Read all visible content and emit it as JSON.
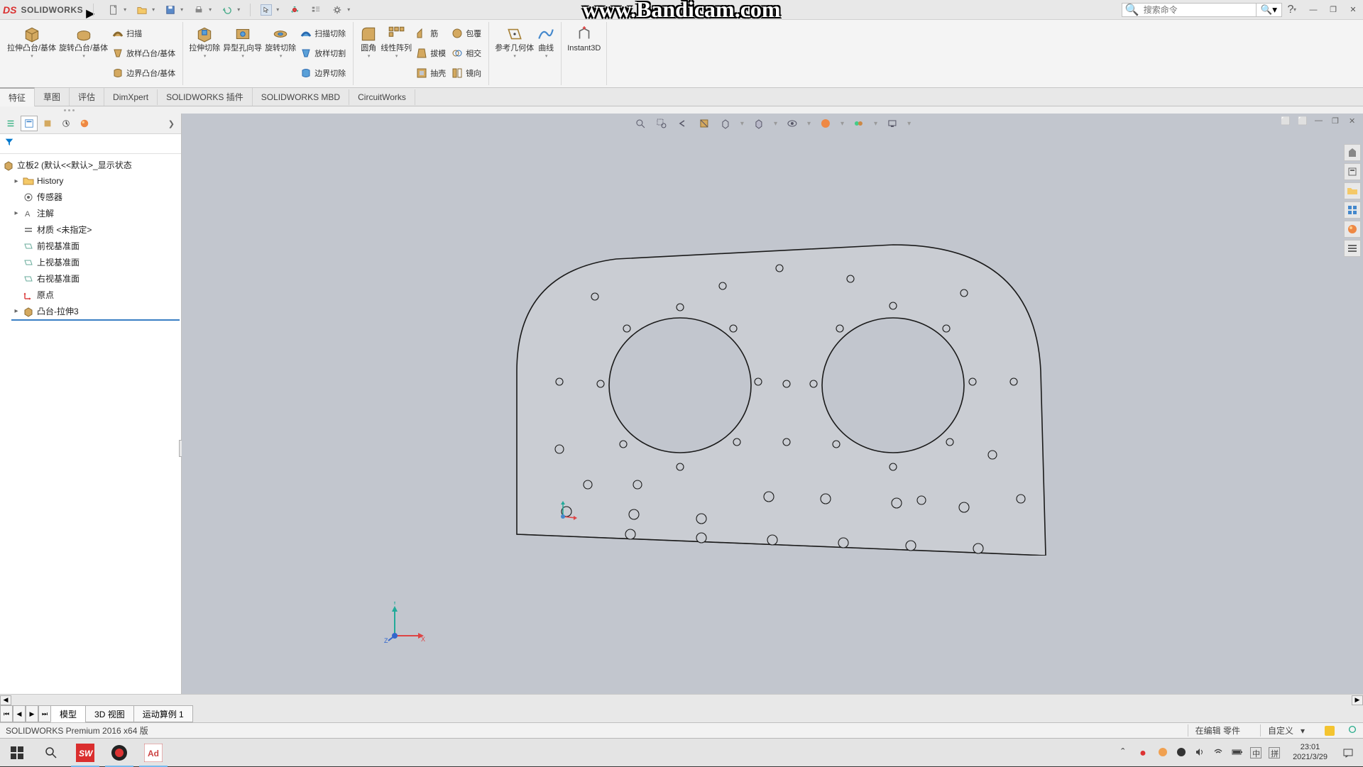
{
  "app": {
    "logo": "DS",
    "name": "SOLIDWORKS",
    "watermark": "www.Bandicam.com",
    "search_placeholder": "搜索命令",
    "help_label": "?"
  },
  "ribbon": {
    "groups": {
      "extrude_boss": "拉伸凸台/基体",
      "revolve_boss": "旋转凸台/基体",
      "swept_boss": "扫描",
      "loft_boss": "放样凸台/基体",
      "boundary_boss": "边界凸台/基体",
      "extrude_cut": "拉伸切除",
      "hole_wizard": "异型孔向导",
      "revolve_cut": "旋转切除",
      "swept_cut": "扫描切除",
      "loft_cut": "放样切割",
      "boundary_cut": "边界切除",
      "fillet": "圆角",
      "linear_pattern": "线性阵列",
      "rib": "筋",
      "draft": "拔模",
      "shell": "抽壳",
      "wrap": "包覆",
      "intersect": "相交",
      "mirror": "镜向",
      "ref_geom": "参考几何体",
      "curves": "曲线",
      "instant3d": "Instant3D"
    }
  },
  "tabs": {
    "features": "特征",
    "sketch": "草图",
    "evaluate": "评估",
    "dimxpert": "DimXpert",
    "sw_addins": "SOLIDWORKS 插件",
    "sw_mbd": "SOLIDWORKS MBD",
    "circuitworks": "CircuitWorks"
  },
  "tree": {
    "root": "立板2 (默认<<默认>_显示状态",
    "history": "History",
    "sensors": "传感器",
    "annotations": "注解",
    "material": "材质 <未指定>",
    "front_plane": "前视基准面",
    "top_plane": "上视基准面",
    "right_plane": "右视基准面",
    "origin": "原点",
    "feature1": "凸台-拉伸3"
  },
  "bottom_tabs": {
    "model": "模型",
    "view3d": "3D 视图",
    "motion": "运动算例 1"
  },
  "status": {
    "product": "SOLIDWORKS Premium 2016 x64 版",
    "editing": "在编辑 零件",
    "custom": "自定义"
  },
  "taskbar": {
    "ime1": "中",
    "ime2": "拼",
    "time": "23:01",
    "date": "2021/3/29"
  },
  "triad": {
    "x": "X",
    "y": "Y",
    "z": "Z"
  }
}
